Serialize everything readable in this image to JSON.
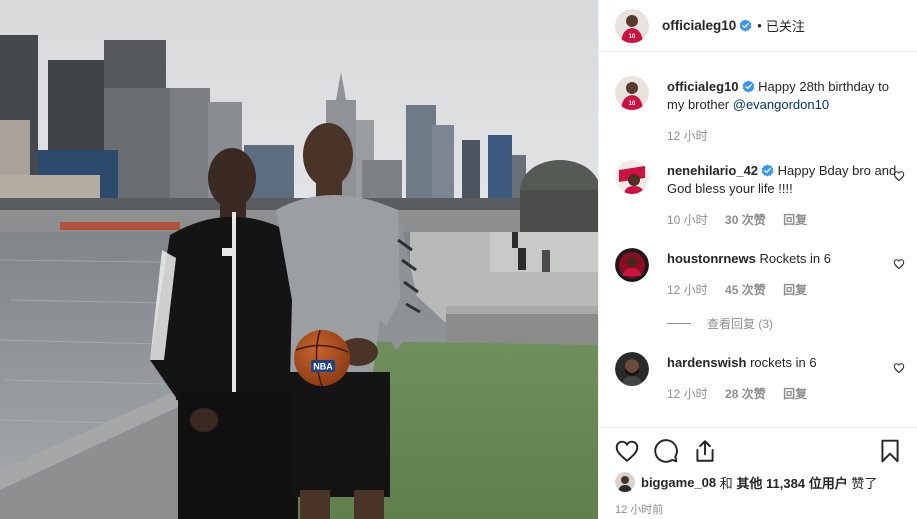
{
  "post": {
    "author": {
      "username": "officialeg10",
      "verified": true,
      "follow_state": "已关注",
      "separator": "•"
    },
    "caption": {
      "username": "officialeg10",
      "text": "Happy 28th birthday to my brother ",
      "mention": "@evangordon10",
      "time": "12 小时"
    },
    "comments": [
      {
        "username": "nenehilario_42",
        "verified": true,
        "text": "Happy Bday bro and God bless your life !!!!",
        "time": "10 小时",
        "likes": "30 次赞",
        "reply": "回复"
      },
      {
        "username": "houstonrnews",
        "verified": false,
        "text": "Rockets in 6",
        "time": "12 小时",
        "likes": "45 次赞",
        "reply": "回复",
        "view_replies": "查看回复 (3)"
      },
      {
        "username": "hardenswish",
        "verified": false,
        "text": "rockets in 6",
        "time": "12 小时",
        "likes": "28 次赞",
        "reply": "回复"
      }
    ],
    "liked_by": {
      "username": "biggame_08",
      "and": "和",
      "others": "其他 11,384 位用户",
      "suffix": "赞了"
    },
    "posted_time": "12 小时前",
    "photo": {
      "ball_text": "NBA"
    },
    "icons": {
      "like": "heart-icon",
      "comment": "comment-icon",
      "share": "share-icon",
      "save": "bookmark-icon",
      "verified": "verified-badge-icon"
    },
    "colors": {
      "link": "#00376b",
      "muted": "#8e8e8e",
      "verified": "#3897f0",
      "rockets_red": "#ce1141"
    }
  }
}
